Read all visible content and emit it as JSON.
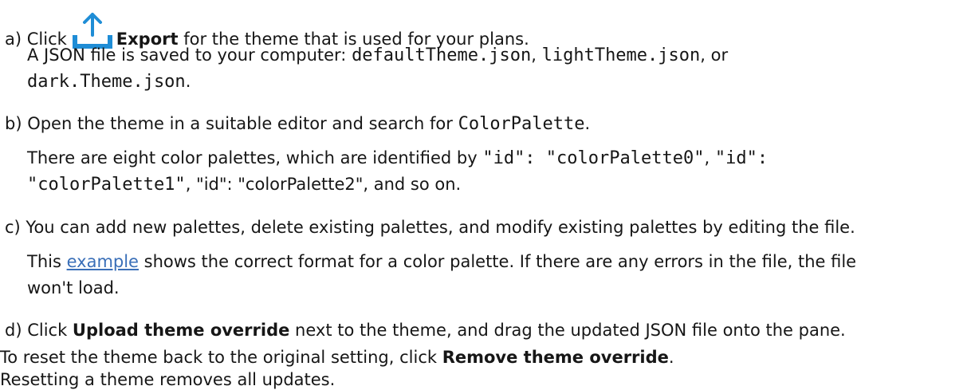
{
  "step_a": {
    "prefix": "a) Click",
    "button": "Export",
    "suffix": " for the theme that is used for your plans.",
    "note_prefix": "A JSON file is saved to your computer: ",
    "file1": "defaultTheme.json",
    "sep1": ", ",
    "file2": "lightTheme.json",
    "sep2": ", or",
    "file3": "dark.Theme.json",
    "note_end": ".",
    "icon": "upload-arrow-icon",
    "icon_color": "#1f8dd6"
  },
  "step_b": {
    "prefix": "b) Open the theme in a suitable editor and search for ",
    "code": "ColorPalette",
    "end": ".",
    "note_prefix": "There are eight color palettes, which are identified by ",
    "id0": "\"id\": \"colorPalette0\"",
    "sep1": ", ",
    "id1a": "\"id\":",
    "id1b": "\"colorPalette1\"",
    "mid": ", \"id\": \"colorPalette2\", and so on."
  },
  "step_c": {
    "text": "c) You can add new palettes, delete existing palettes, and modify existing palettes by editing the file.",
    "note_prefix": "This ",
    "link": "example",
    "note_line1": " shows the correct format for a color palette. If there are any errors in the file, the file",
    "note_line2": "won't load.",
    "link_color": "#3a6fb8"
  },
  "step_d": {
    "prefix": "d) Click ",
    "button": "Upload theme override",
    "suffix": " next to the theme, and drag the updated JSON file onto the pane."
  },
  "reset": {
    "prefix": "To reset the theme back to the original setting, click ",
    "button": "Remove theme override",
    "end": "."
  },
  "reset_note": "Resetting a theme removes all updates."
}
